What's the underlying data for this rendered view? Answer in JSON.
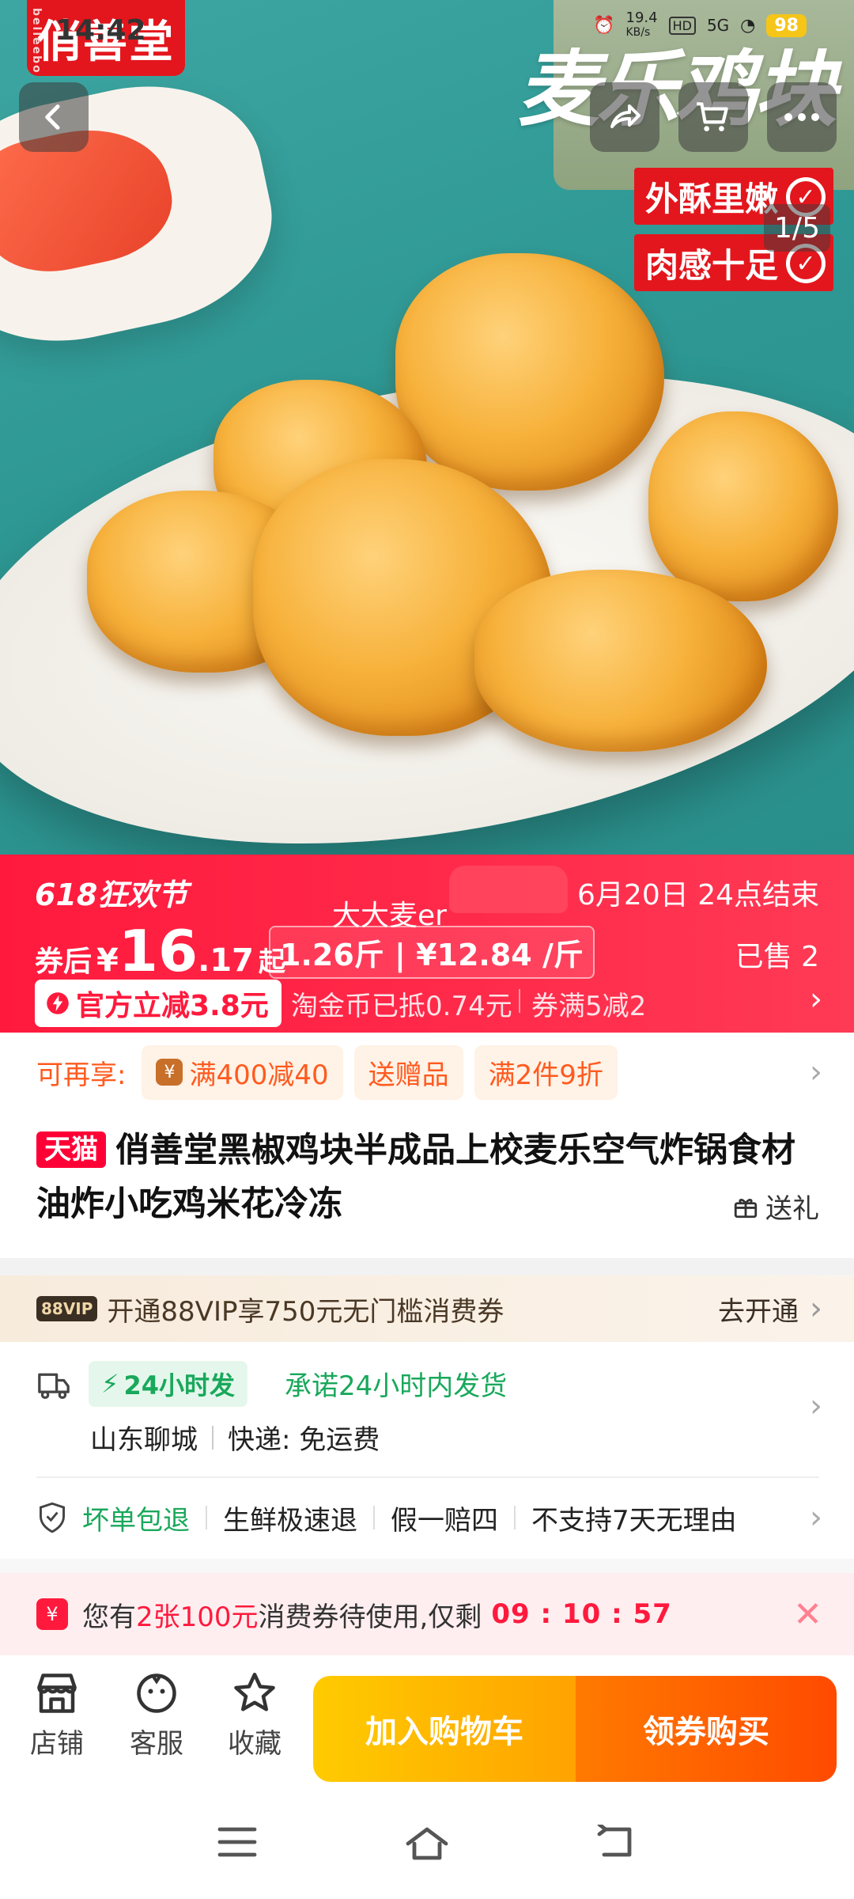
{
  "status_bar": {
    "time": "14:42",
    "net_speed": "19.4",
    "net_unit": "KB/s",
    "hd": "HD",
    "signal": "5G",
    "battery": "98"
  },
  "hero": {
    "brand_logo": "俏善堂",
    "brand_sub": "belleebo",
    "product_title": "麦乐鸡块",
    "tag_1": "外酥里嫩",
    "tag_2": "肉感十足",
    "image_counter": "1/5"
  },
  "price_banner": {
    "promo_name": "618狂欢节",
    "end_time": "6月20日 24点结束",
    "user_name": "大大麦er",
    "after_coupon_label": "券后",
    "currency": "¥",
    "price_int": "16",
    "price_dec": ".17",
    "price_suffix": "起",
    "unit_price": "1.26斤 | ¥12.84 /斤",
    "sold": "已售 2",
    "official_discount": "官方立减3.8元",
    "coin_text": "淘金币已抵0.74元",
    "coupon_text": "券满5减2"
  },
  "benefits": {
    "heading": "可再享:",
    "chips": [
      "满400减40",
      "送赠品",
      "满2件9折"
    ]
  },
  "product": {
    "platform_badge": "天猫",
    "title": "俏善堂黑椒鸡块半成品上校麦乐空气炸锅食材油炸小吃鸡米花冷冻",
    "gift_label": "送礼"
  },
  "vip": {
    "badge": "88VIP",
    "text": "开通88VIP享750元无门槛消费券",
    "action": "去开通"
  },
  "delivery": {
    "fast_badge": "24小时发",
    "promise": "承诺24小时内发货",
    "origin": "山东聊城",
    "shipping": "快递: 免运费"
  },
  "guarantees": [
    "坏单包退",
    "生鲜极速退",
    "假一赔四",
    "不支持7天无理由"
  ],
  "coupon_reminder": {
    "prefix": "您有",
    "highlight": "2张100元",
    "suffix": "消费券待使用,仅剩",
    "timer": "09 : 10 : 57"
  },
  "action_bar": {
    "shop": "店铺",
    "service": "客服",
    "favorite": "收藏",
    "add_to_cart": "加入购物车",
    "buy": "领券购买"
  },
  "colors": {
    "accent_red": "#ff1a3d",
    "green": "#19a85b",
    "orange": "#ff5a1f",
    "cart_yellow": "#ffb300",
    "buy_orange": "#ff5a00"
  }
}
